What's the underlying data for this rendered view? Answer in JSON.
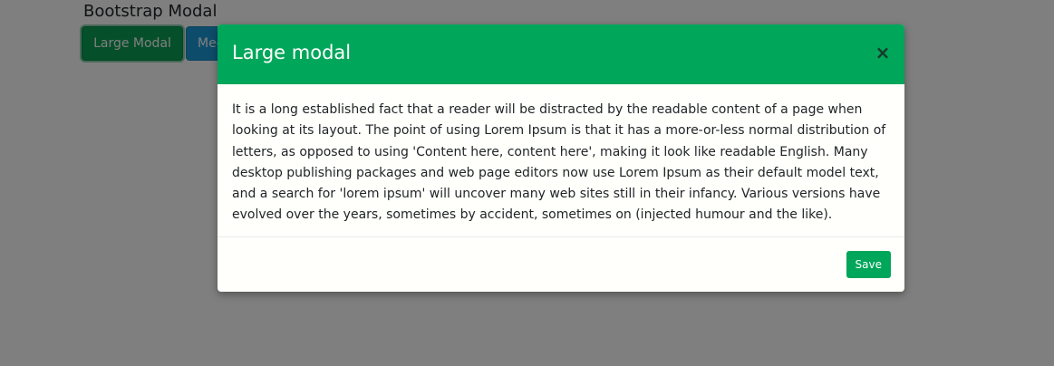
{
  "page": {
    "title": "Bootstrap Modal",
    "buttons": {
      "large_label": "Large Modal",
      "medium_label": "Medium Modal"
    }
  },
  "modal": {
    "title": "Large modal",
    "close_icon": "close-icon",
    "close_glyph": "×",
    "body_text": "It is a long established fact that a reader will be distracted by the readable content of a page when looking at its layout. The point of using Lorem Ipsum is that it has a more-or-less normal distribution of letters, as opposed to using 'Content here, content here', making it look like readable English. Many desktop publishing packages and web page editors now use Lorem Ipsum as their default model text, and a search for 'lorem ipsum' will uncover many web sites still in their infancy. Various versions have evolved over the years, sometimes by accident, sometimes on (injected humour and the like).",
    "save_label": "Save"
  },
  "colors": {
    "header_green": "#00a65a",
    "large_button": "#0a9f55",
    "medium_button": "#1a9ad6",
    "backdrop": "rgba(0,0,0,0.5)"
  }
}
